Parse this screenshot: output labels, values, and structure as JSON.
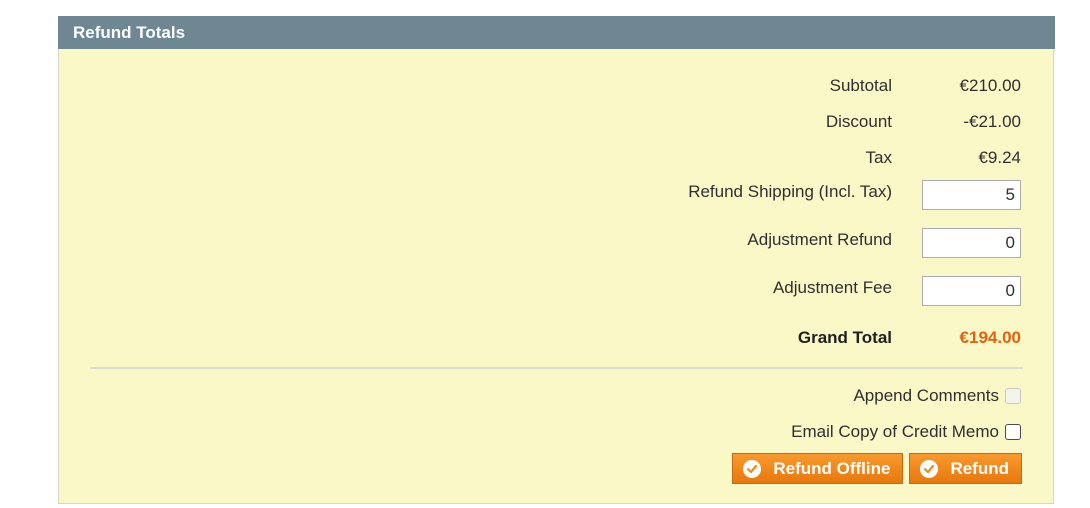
{
  "panel": {
    "title": "Refund Totals"
  },
  "totals": {
    "subtotal_label": "Subtotal",
    "subtotal_value": "€210.00",
    "discount_label": "Discount",
    "discount_value": "-€21.00",
    "tax_label": "Tax",
    "tax_value": "€9.24",
    "shipping_label": "Refund Shipping (Incl. Tax)",
    "shipping_value": "5",
    "adjustment_refund_label": "Adjustment Refund",
    "adjustment_refund_value": "0",
    "adjustment_fee_label": "Adjustment Fee",
    "adjustment_fee_value": "0",
    "grand_total_label": "Grand Total",
    "grand_total_value": "€194.00"
  },
  "options": {
    "append_comments_label": "Append Comments",
    "append_comments_checked": false,
    "append_comments_disabled": true,
    "email_copy_label": "Email Copy of Credit Memo",
    "email_copy_checked": false
  },
  "actions": {
    "refund_offline_label": "Refund Offline",
    "refund_label": "Refund"
  },
  "colors": {
    "header": "#6e8793",
    "panel_bg": "#fbf8c8",
    "accent": "#e2620d",
    "button": "#f18a1c"
  }
}
